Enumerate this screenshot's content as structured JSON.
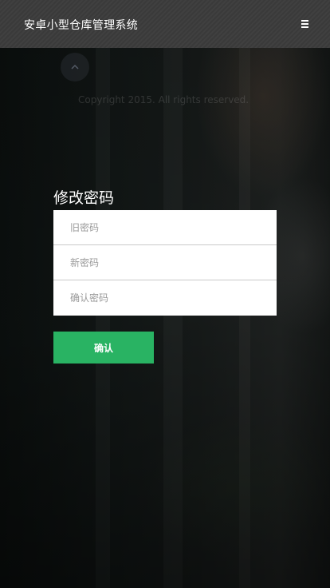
{
  "header": {
    "title": "安卓小型仓库管理系统",
    "menu_icon": "hamburger-menu-icon"
  },
  "back_to_top": {
    "icon": "chevron-up-icon"
  },
  "footer": {
    "copyright": "Copyright 2015. All rights reserved."
  },
  "form": {
    "title": "修改密码",
    "old_password_placeholder": "旧密码",
    "new_password_placeholder": "新密码",
    "confirm_password_placeholder": "确认密码",
    "submit_label": "确认"
  },
  "colors": {
    "header_bg": "#3b3b3b",
    "primary_button": "#29b363"
  }
}
